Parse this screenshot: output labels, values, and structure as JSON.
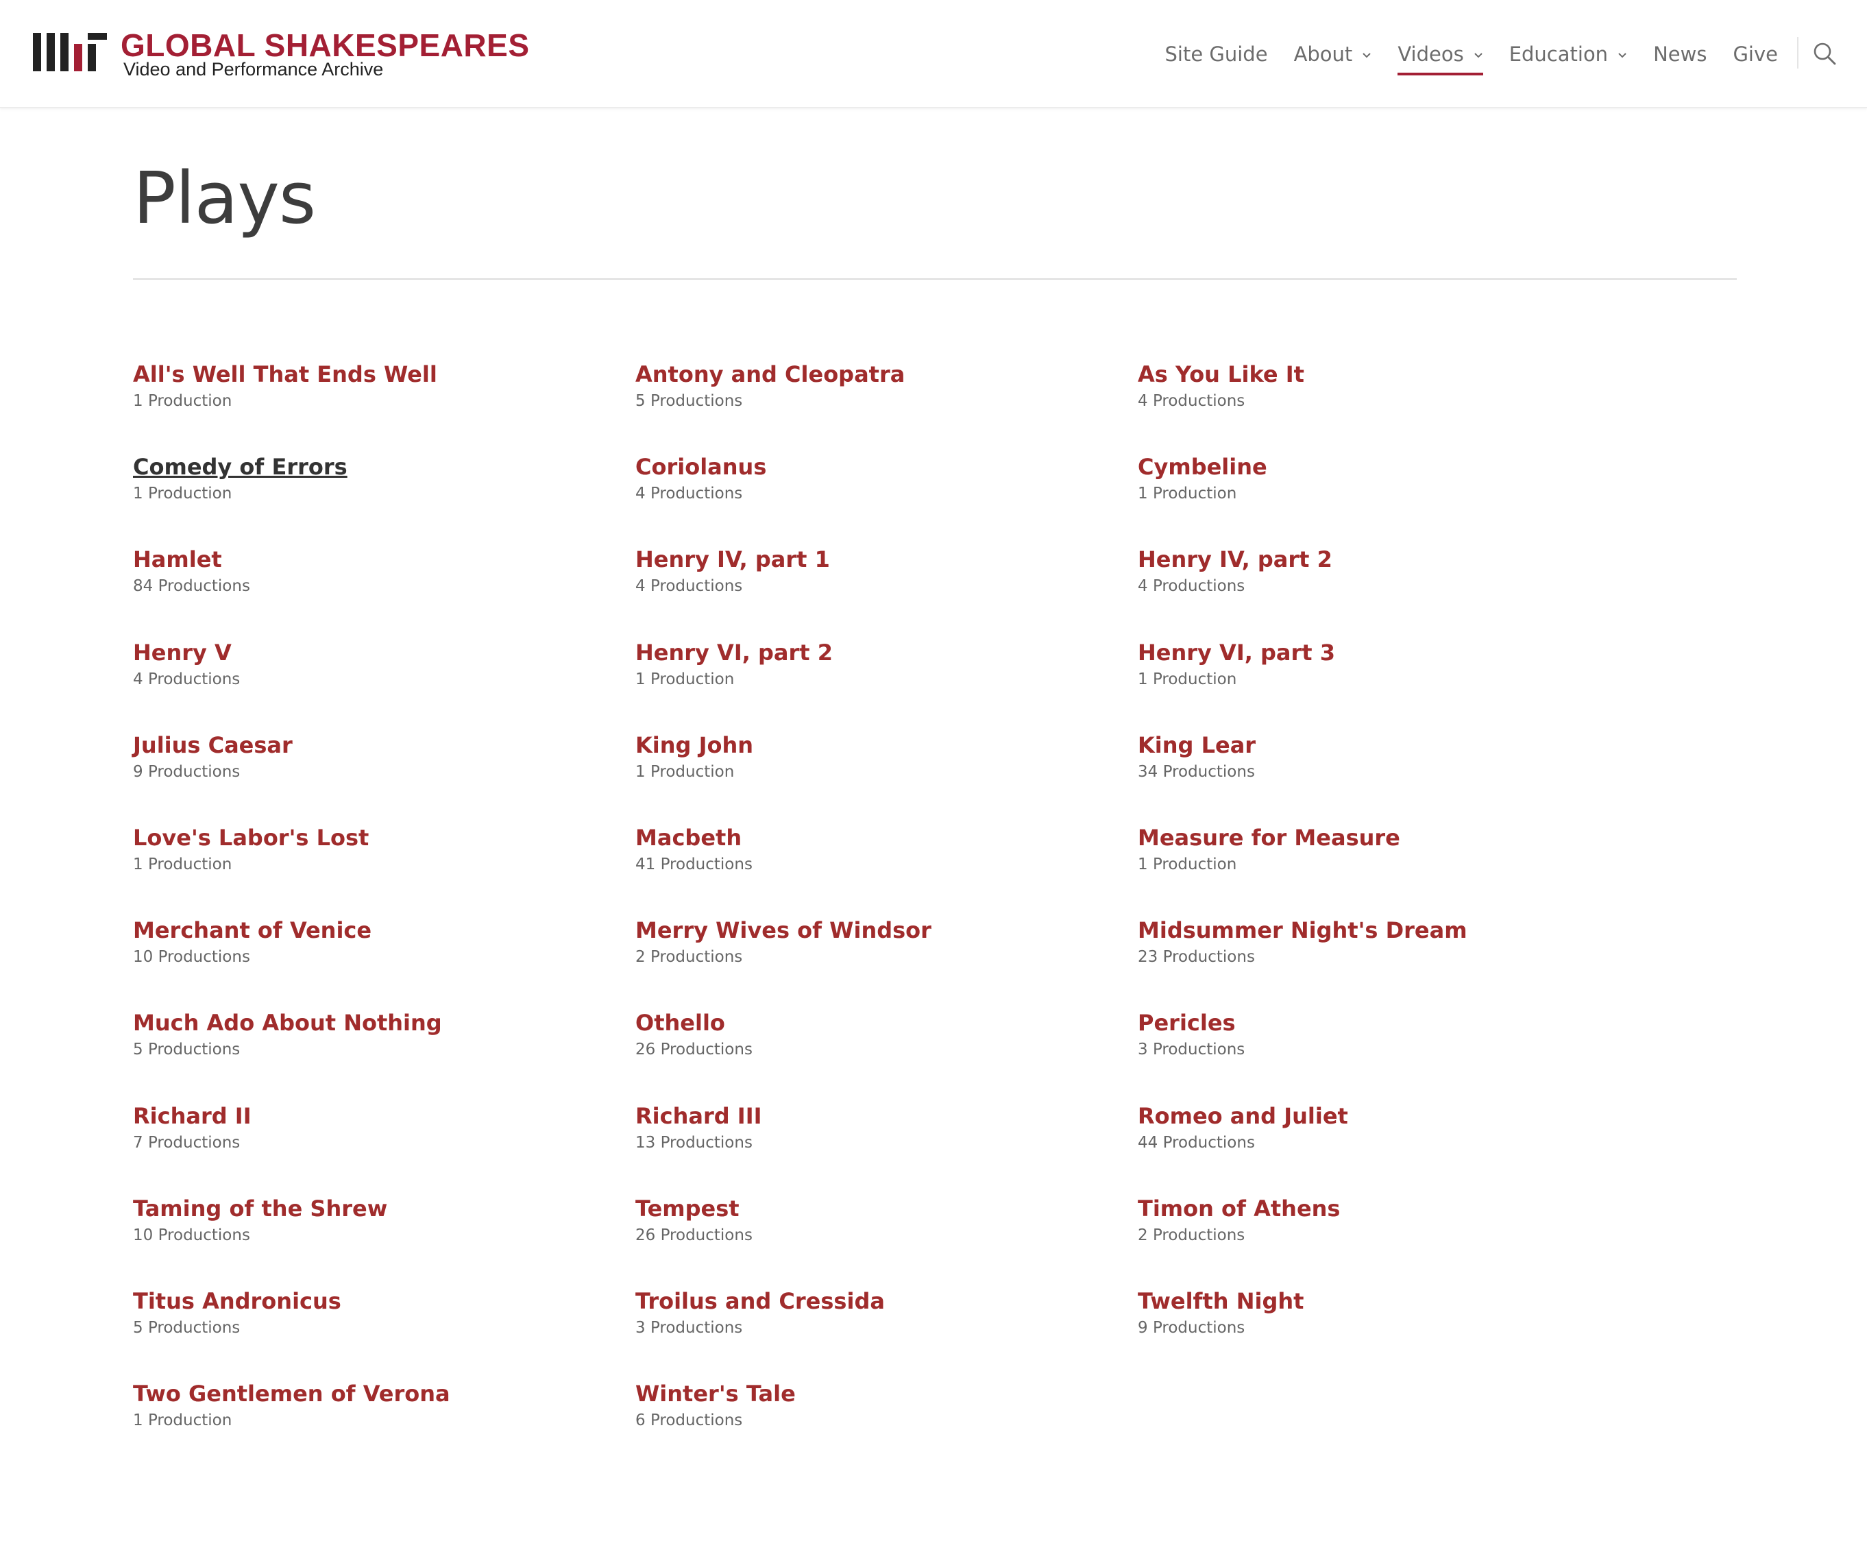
{
  "site": {
    "logo_main": "GLOBAL SHAKESPEARES",
    "logo_sub": "Video and Performance Archive",
    "brand_color": "#a31f34",
    "logo_mark_icon": "mit-logo-icon"
  },
  "nav": {
    "items": [
      {
        "label": "Site Guide",
        "has_dropdown": false,
        "active": false
      },
      {
        "label": "About",
        "has_dropdown": true,
        "active": false
      },
      {
        "label": "Videos",
        "has_dropdown": true,
        "active": true
      },
      {
        "label": "Education",
        "has_dropdown": true,
        "active": false
      },
      {
        "label": "News",
        "has_dropdown": false,
        "active": false
      },
      {
        "label": "Give",
        "has_dropdown": false,
        "active": false
      }
    ],
    "chevron_glyph": "⌄",
    "search_icon": "search-icon"
  },
  "page": {
    "title": "Plays"
  },
  "plays": [
    {
      "name": "All's Well That Ends Well",
      "count": "1 Production"
    },
    {
      "name": "Antony and Cleopatra",
      "count": "5 Productions"
    },
    {
      "name": "As You Like It",
      "count": "4 Productions"
    },
    {
      "name": "Comedy of Errors",
      "count": "1 Production",
      "hovered": true
    },
    {
      "name": "Coriolanus",
      "count": "4 Productions"
    },
    {
      "name": "Cymbeline",
      "count": "1 Production"
    },
    {
      "name": "Hamlet",
      "count": "84 Productions"
    },
    {
      "name": "Henry IV, part 1",
      "count": "4 Productions"
    },
    {
      "name": "Henry IV, part 2",
      "count": "4 Productions"
    },
    {
      "name": "Henry V",
      "count": "4 Productions"
    },
    {
      "name": "Henry VI, part 2",
      "count": "1 Production"
    },
    {
      "name": "Henry VI, part 3",
      "count": "1 Production"
    },
    {
      "name": "Julius Caesar",
      "count": "9 Productions"
    },
    {
      "name": "King John",
      "count": "1 Production"
    },
    {
      "name": "King Lear",
      "count": "34 Productions"
    },
    {
      "name": "Love's Labor's Lost",
      "count": "1 Production"
    },
    {
      "name": "Macbeth",
      "count": "41 Productions"
    },
    {
      "name": "Measure for Measure",
      "count": "1 Production"
    },
    {
      "name": "Merchant of Venice",
      "count": "10 Productions"
    },
    {
      "name": "Merry Wives of Windsor",
      "count": "2 Productions"
    },
    {
      "name": "Midsummer Night's Dream",
      "count": "23 Productions"
    },
    {
      "name": "Much Ado About Nothing",
      "count": "5 Productions"
    },
    {
      "name": "Othello",
      "count": "26 Productions"
    },
    {
      "name": "Pericles",
      "count": "3 Productions"
    },
    {
      "name": "Richard II",
      "count": "7 Productions"
    },
    {
      "name": "Richard III",
      "count": "13 Productions"
    },
    {
      "name": "Romeo and Juliet",
      "count": "44 Productions"
    },
    {
      "name": "Taming of the Shrew",
      "count": "10 Productions"
    },
    {
      "name": "Tempest",
      "count": "26 Productions"
    },
    {
      "name": "Timon of Athens",
      "count": "2 Productions"
    },
    {
      "name": "Titus Andronicus",
      "count": "5 Productions"
    },
    {
      "name": "Troilus and Cressida",
      "count": "3 Productions"
    },
    {
      "name": "Twelfth Night",
      "count": "9 Productions"
    },
    {
      "name": "Two Gentlemen of Verona",
      "count": "1 Production"
    },
    {
      "name": "Winter's Tale",
      "count": "6 Productions"
    }
  ],
  "colors": {
    "link": "#a02c2c",
    "link_hover": "#333333",
    "title": "#3d3d3d",
    "meta": "#666666",
    "nav_text": "#6c6c6c"
  }
}
